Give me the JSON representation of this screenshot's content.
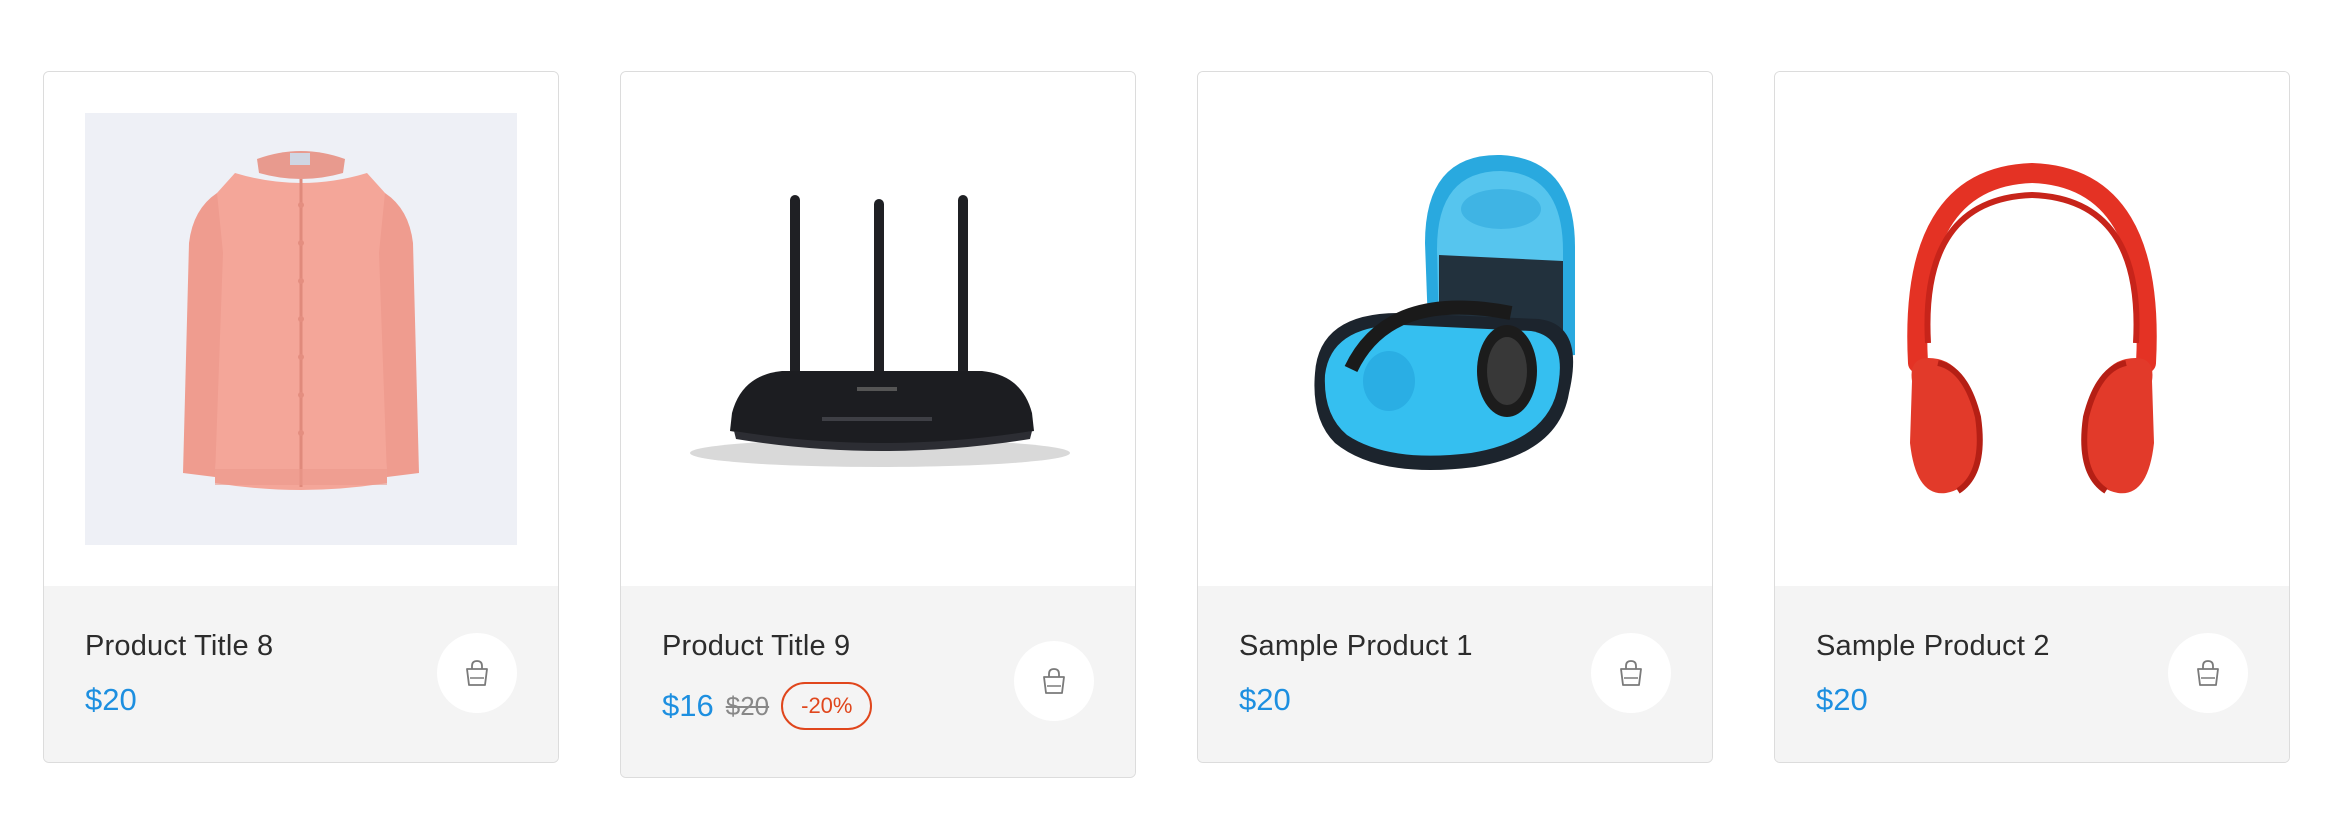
{
  "products": [
    {
      "title": "Product Title 8",
      "price": "$20",
      "image": "pink-cardigan"
    },
    {
      "title": "Product Title 9",
      "price": "$16",
      "old_price": "$20",
      "discount": "-20%",
      "image": "black-router"
    },
    {
      "title": "Sample Product 1",
      "price": "$20",
      "image": "headphones-in-blue-case"
    },
    {
      "title": "Sample Product 2",
      "price": "$20",
      "image": "red-headphones"
    }
  ],
  "icons": {
    "cart": "shopping-bag-icon"
  },
  "colors": {
    "price": "#1d8fe0",
    "discount": "#e0461c",
    "info_bg": "#f4f4f4",
    "card_border": "#dcdcdc"
  }
}
